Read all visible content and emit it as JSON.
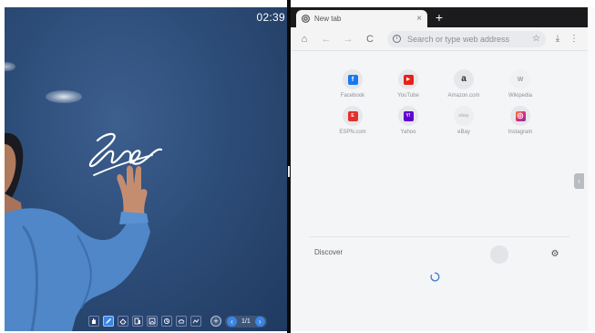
{
  "whiteboard": {
    "clock": "02:39",
    "toolbar": {
      "tools": [
        {
          "name": "hand-tool-icon",
          "active": false
        },
        {
          "name": "pen-tool-icon",
          "active": true
        },
        {
          "name": "eraser-tool-icon",
          "active": false
        },
        {
          "name": "shape-tool-icon",
          "active": false
        },
        {
          "name": "image-tool-icon",
          "active": false
        },
        {
          "name": "undo-tool-icon",
          "active": false
        },
        {
          "name": "redo-tool-icon",
          "active": false
        },
        {
          "name": "more-tool-icon",
          "active": false
        }
      ],
      "add_page_label": "+",
      "prev_label": "‹",
      "next_label": "›",
      "page_indicator": "1/1"
    }
  },
  "browser": {
    "tab": {
      "title": "New tab",
      "close_label": "×"
    },
    "new_tab_label": "+",
    "nav": {
      "home": "⌂",
      "back": "←",
      "forward": "→",
      "reload": "C"
    },
    "omnibox": {
      "placeholder": "Search or type web address",
      "info": "i",
      "star": "☆"
    },
    "download_icon": "⤓",
    "menu_icon": "⋮",
    "shortcuts": [
      {
        "label": "Facebook",
        "glyph": "f",
        "color": "#1877f2"
      },
      {
        "label": "YouTube",
        "glyph": "▶",
        "color": "#e62117"
      },
      {
        "label": "Amazon.com",
        "glyph": "a",
        "color": "#2b2b2b"
      },
      {
        "label": "Wikipedia",
        "glyph": "W",
        "color": "#9ea0a4"
      },
      {
        "label": "ESPN.com",
        "glyph": "E",
        "color": "#e2312b"
      },
      {
        "label": "Yahoo",
        "glyph": "Y!",
        "color": "#5f01d1"
      },
      {
        "label": "eBay",
        "glyph": "ebay",
        "color": "#b8bbc0"
      },
      {
        "label": "Instagram",
        "glyph": "◎",
        "color": "#e1306c"
      }
    ],
    "discover_label": "Discover",
    "settings_icon": "⚙",
    "side_handle_glyph": "‹"
  }
}
